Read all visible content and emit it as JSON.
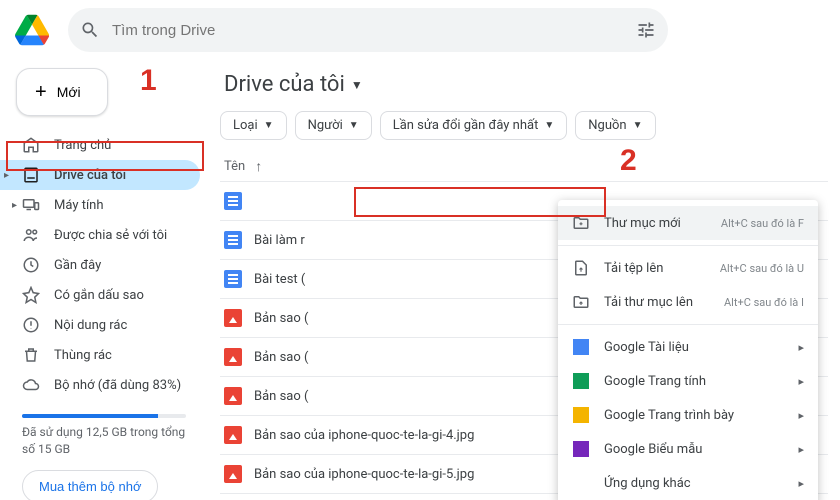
{
  "search": {
    "placeholder": "Tìm trong Drive"
  },
  "new_button": "Mới",
  "sidebar": {
    "items": [
      {
        "label": "Trang chủ"
      },
      {
        "label": "Drive của tôi"
      },
      {
        "label": "Máy tính"
      },
      {
        "label": "Được chia sẻ với tôi"
      },
      {
        "label": "Gần đây"
      },
      {
        "label": "Có gắn dấu sao"
      },
      {
        "label": "Nội dung rác"
      },
      {
        "label": "Thùng rác"
      },
      {
        "label": "Bộ nhớ (đã dùng 83%)"
      }
    ],
    "storage_text": "Đã sử dụng 12,5 GB trong tổng số 15 GB",
    "buy": "Mua thêm bộ nhớ"
  },
  "main_title": "Drive của tôi",
  "filters": [
    {
      "label": "Loại"
    },
    {
      "label": "Người"
    },
    {
      "label": "Lần sửa đổi gần đây nhất"
    },
    {
      "label": "Nguồn"
    }
  ],
  "list_header": "Tên",
  "files": [
    {
      "name": "",
      "type": "doc"
    },
    {
      "name": "Bài làm r",
      "type": "doc"
    },
    {
      "name": "Bài test (",
      "type": "doc"
    },
    {
      "name": "Bản sao (",
      "type": "img"
    },
    {
      "name": "Bản sao (",
      "type": "img"
    },
    {
      "name": "Bản sao (",
      "type": "img"
    },
    {
      "name": "Bản sao của iphone-quoc-te-la-gi-4.jpg",
      "type": "img"
    },
    {
      "name": "Bản sao của iphone-quoc-te-la-gi-5.jpg",
      "type": "img"
    }
  ],
  "ctx": [
    {
      "label": "Thư mục mới",
      "shortcut": "Alt+C sau đó là F",
      "icon": "folder",
      "hover": true
    },
    {
      "sep": true
    },
    {
      "label": "Tải tệp lên",
      "shortcut": "Alt+C sau đó là U",
      "icon": "upload-file",
      "highlight": true
    },
    {
      "label": "Tải thư mục lên",
      "shortcut": "Alt+C sau đó là I",
      "icon": "upload-folder"
    },
    {
      "sep": true
    },
    {
      "label": "Google Tài liệu",
      "icon": "docs",
      "sub": true
    },
    {
      "label": "Google Trang tính",
      "icon": "sheets",
      "sub": true
    },
    {
      "label": "Google Trang trình bày",
      "icon": "slides",
      "sub": true
    },
    {
      "label": "Google Biểu mẫu",
      "icon": "forms",
      "sub": true
    },
    {
      "label": "Ứng dụng khác",
      "icon": "",
      "sub": true
    }
  ],
  "annotations": {
    "one": "1",
    "two": "2"
  }
}
